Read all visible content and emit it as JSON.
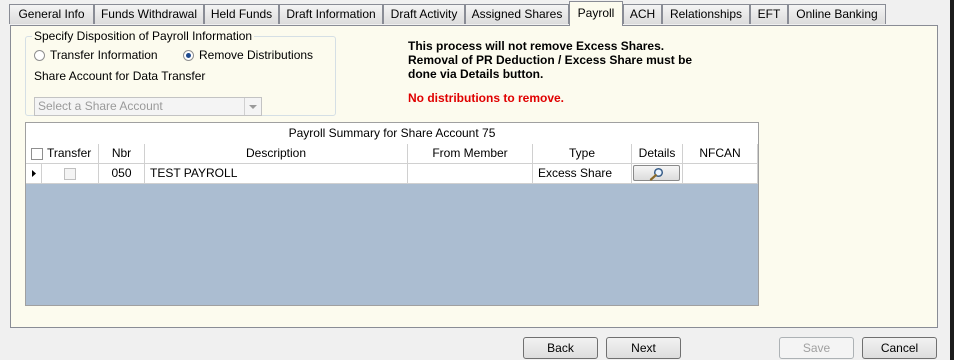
{
  "tabs": [
    {
      "label": "General Info"
    },
    {
      "label": "Funds Withdrawal"
    },
    {
      "label": "Held Funds"
    },
    {
      "label": "Draft Information"
    },
    {
      "label": "Draft Activity"
    },
    {
      "label": "Assigned Shares"
    },
    {
      "label": "Payroll",
      "active": true
    },
    {
      "label": "ACH"
    },
    {
      "label": "Relationships"
    },
    {
      "label": "EFT"
    },
    {
      "label": "Online Banking"
    }
  ],
  "disposition": {
    "group_title": "Specify Disposition of Payroll Information",
    "options": [
      {
        "label": "Transfer Information",
        "selected": false
      },
      {
        "label": "Remove Distributions",
        "selected": true
      }
    ],
    "share_account_label": "Share Account for Data Transfer",
    "share_account_placeholder": "Select a Share Account"
  },
  "notice": {
    "lines": [
      "This process will not remove Excess Shares.",
      "Removal of PR Deduction / Excess Share must be",
      "done via Details button."
    ],
    "warning": "No distributions to remove."
  },
  "grid": {
    "title": "Payroll Summary for Share Account 75",
    "columns": [
      "Transfer",
      "Nbr",
      "Description",
      "From Member",
      "Type",
      "Details",
      "NFCAN"
    ],
    "rows": [
      {
        "transfer": false,
        "nbr": "050",
        "description": "TEST PAYROLL",
        "from_member": "",
        "type": "Excess Share",
        "nfcan": ""
      }
    ]
  },
  "buttons": {
    "back": "Back",
    "next": "Next",
    "save": "Save",
    "cancel": "Cancel"
  },
  "icons": {
    "details": "magnifier-icon",
    "row_selector": "row-pointer-icon"
  }
}
